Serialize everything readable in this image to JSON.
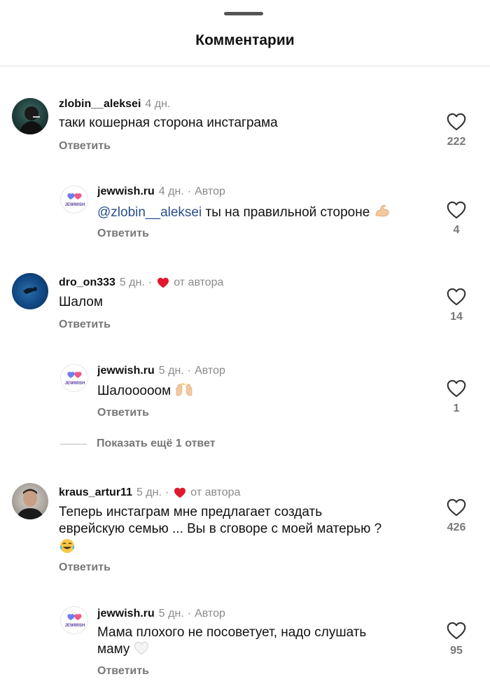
{
  "header": {
    "title": "Комментарии"
  },
  "comments": [
    {
      "username": "zlobin__aleksei",
      "time": "4 дн.",
      "text": "таки кошерная сторона инстаграма",
      "reply_label": "Ответить",
      "likes": "222",
      "replies": [
        {
          "username": "jewwish.ru",
          "time": "4 дн.",
          "author_label": "Автор",
          "mention": "@zlobin__aleksei",
          "text": " ты на правильной стороне",
          "emoji": "💪",
          "reply_label": "Ответить",
          "likes": "4",
          "avatar_text": "JEWWISH"
        }
      ]
    },
    {
      "username": "dro_on333",
      "time": "5 дн.",
      "from_author": "от автора",
      "text": "Шалом",
      "reply_label": "Ответить",
      "likes": "14",
      "replies": [
        {
          "username": "jewwish.ru",
          "time": "5 дн.",
          "author_label": "Автор",
          "text": "Шалооооом",
          "emoji": "🙌",
          "reply_label": "Ответить",
          "likes": "1",
          "avatar_text": "JEWWISH"
        }
      ],
      "more_replies_label": "Показать ещё 1 ответ"
    },
    {
      "username": "kraus_artur11",
      "time": "5 дн.",
      "from_author": "от автора",
      "text_line1": "Теперь инстаграм мне предлагает создать",
      "text_line2": "еврейскую семью ... Вы в сговоре с моей матерью ?",
      "emoji": "😂",
      "reply_label": "Ответить",
      "likes": "426",
      "replies": [
        {
          "username": "jewwish.ru",
          "time": "5 дн.",
          "author_label": "Автор",
          "text_line1": "Мама плохого не посоветует, надо слушать",
          "text_line2": "маму",
          "emoji": "🤍",
          "reply_label": "Ответить",
          "likes": "95",
          "avatar_text": "JEWWISH"
        }
      ]
    }
  ],
  "icons": {
    "like": "heart-outline-icon",
    "author_like": "heart-filled-icon"
  },
  "colors": {
    "mention": "#2a4f8c",
    "heart_red": "#e0182d",
    "muted": "#8a8a8a"
  }
}
